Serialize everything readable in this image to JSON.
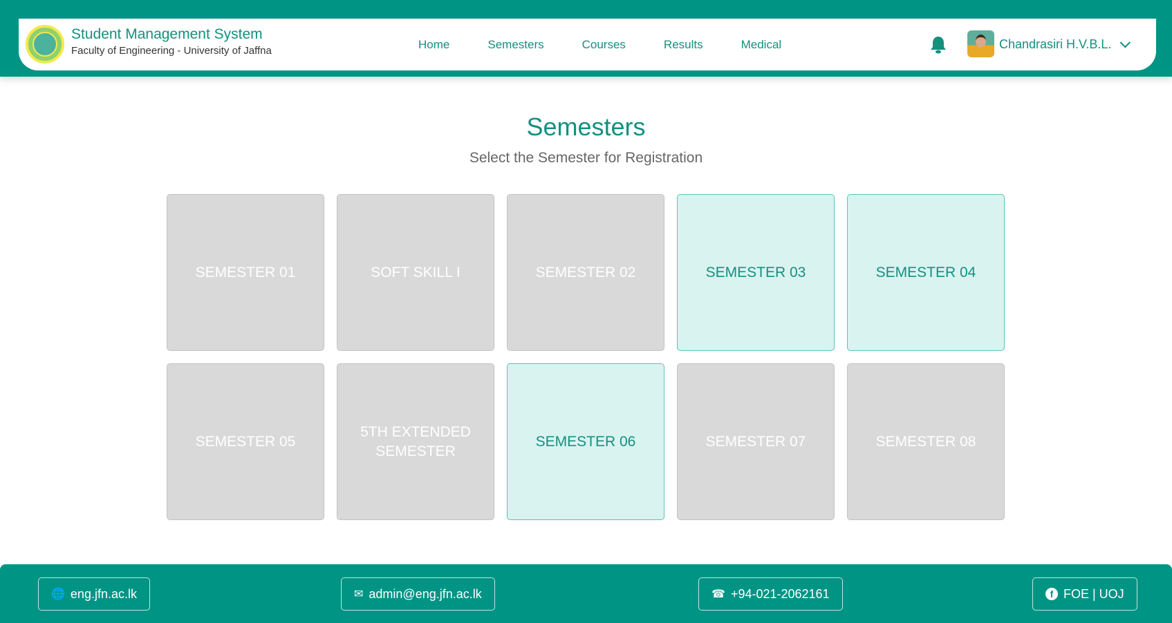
{
  "header": {
    "title": "Student Management System",
    "subtitle": "Faculty of Engineering - University of Jaffna",
    "nav": [
      "Home",
      "Semesters",
      "Courses",
      "Results",
      "Medical"
    ],
    "user": "Chandrasiri H.V.B.L."
  },
  "main": {
    "title": "Semesters",
    "subtitle": "Select the Semester for Registration",
    "semesters": [
      {
        "label": "Semester 01",
        "active": false
      },
      {
        "label": "Soft Skill I",
        "active": false
      },
      {
        "label": "Semester 02",
        "active": false
      },
      {
        "label": "Semester 03",
        "active": true
      },
      {
        "label": "Semester 04",
        "active": true
      },
      {
        "label": "Semester 05",
        "active": false
      },
      {
        "label": "5th Extended Semester",
        "active": false
      },
      {
        "label": "Semester 06",
        "active": true
      },
      {
        "label": "Semester 07",
        "active": false
      },
      {
        "label": "Semester 08",
        "active": false
      }
    ]
  },
  "footer": {
    "website": "eng.jfn.ac.lk",
    "email": "admin@eng.jfn.ac.lk",
    "phone": "+94-021-2062161",
    "facebook": "FOE | UOJ"
  },
  "colors": {
    "brand": "#009485",
    "active_bg": "#d9f3f0",
    "inactive_bg": "#d9d9d9"
  }
}
